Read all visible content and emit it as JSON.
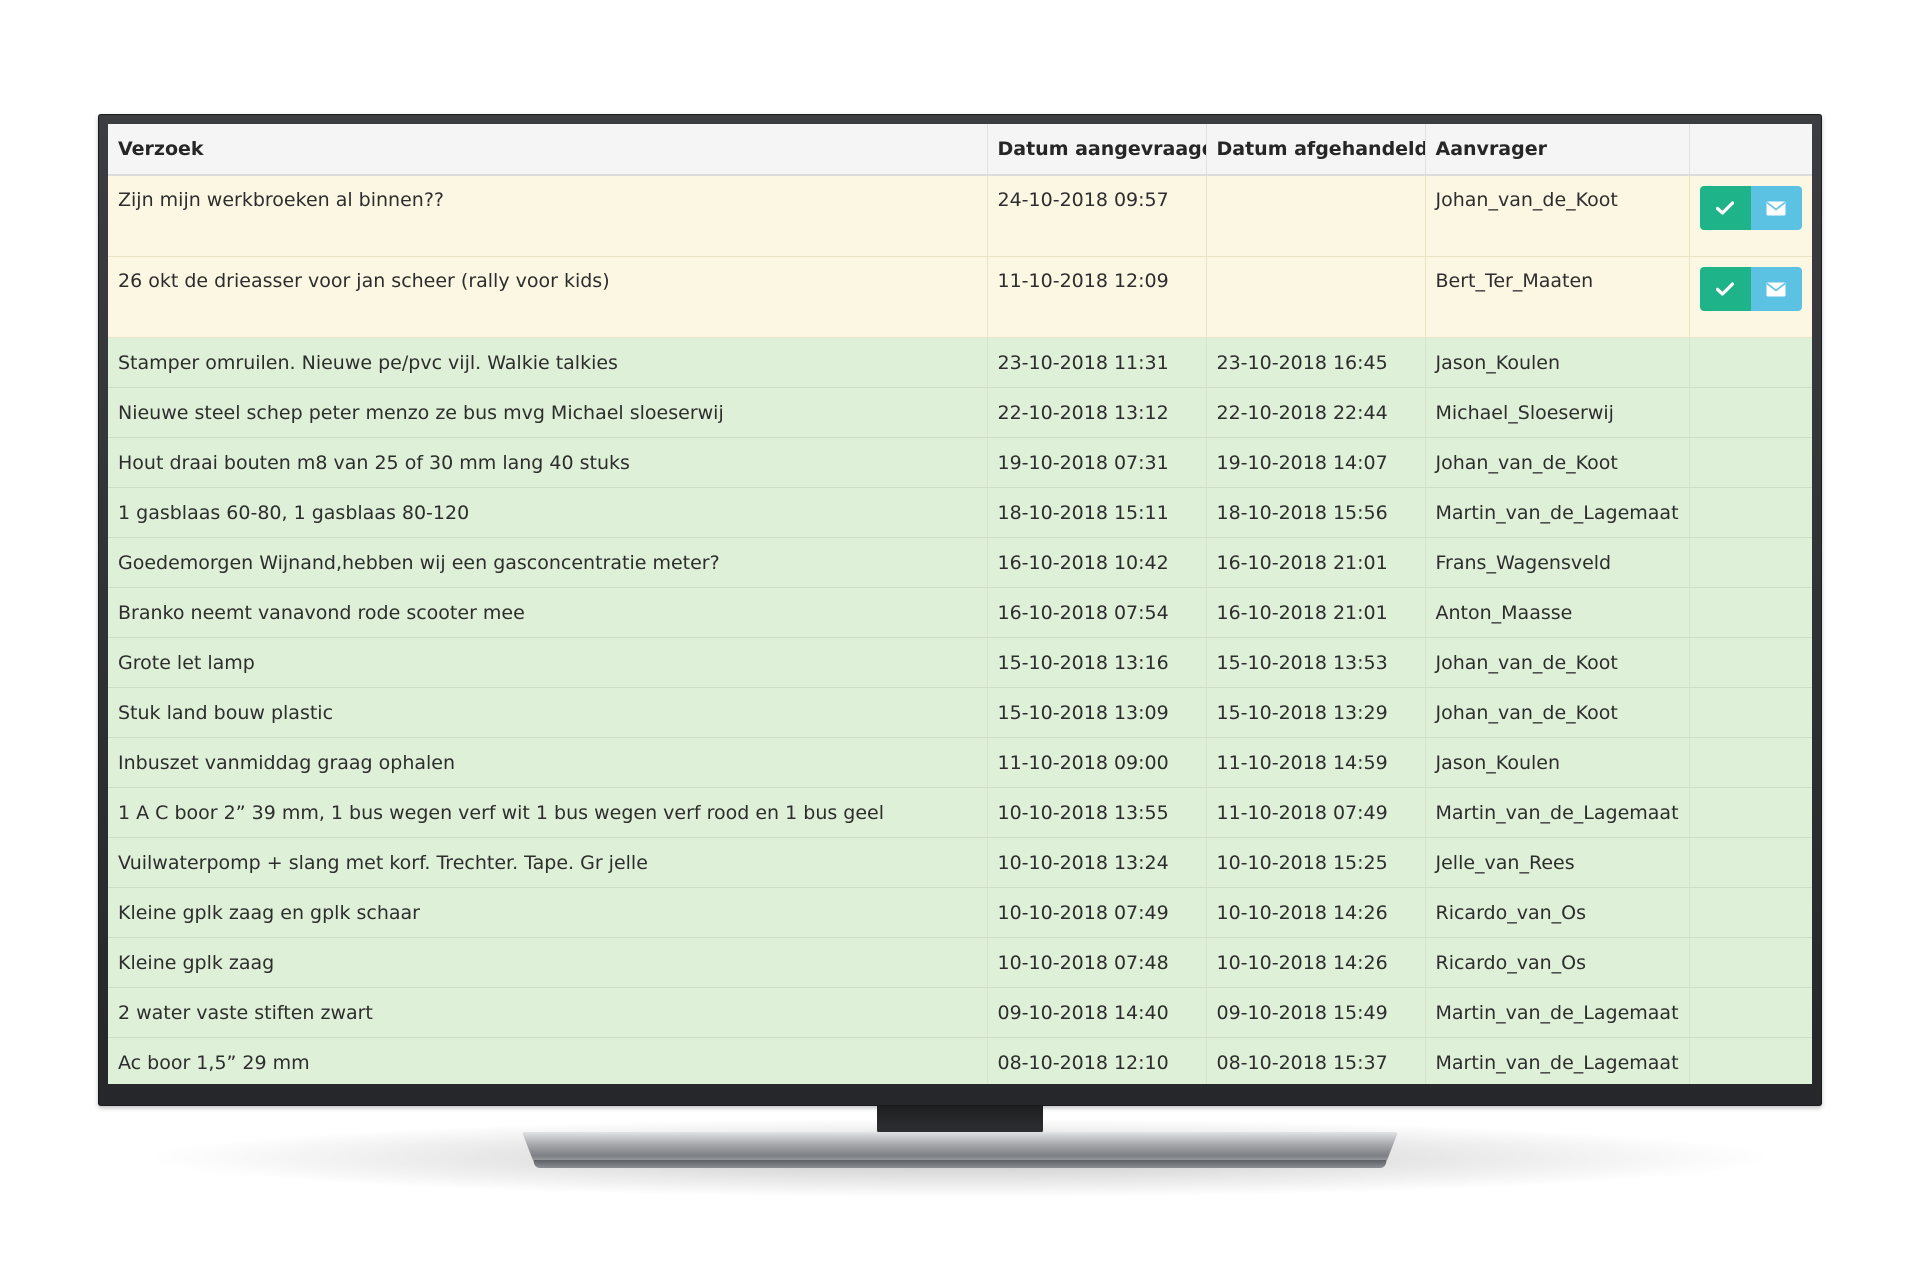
{
  "table": {
    "headers": {
      "request": "Verzoek",
      "date_requested": "Datum aangevraagd",
      "date_handled": "Datum afgehandeld",
      "requester": "Aanvrager",
      "actions": ""
    },
    "pending_rows": [
      {
        "request": "Zijn mijn werkbroeken al binnen??",
        "date_requested": "24-10-2018 09:57",
        "date_handled": "",
        "requester": "Johan_van_de_Koot"
      },
      {
        "request": "26 okt de drieasser voor jan scheer (rally voor kids)",
        "date_requested": "11-10-2018 12:09",
        "date_handled": "",
        "requester": "Bert_Ter_Maaten"
      }
    ],
    "done_rows": [
      {
        "request": "Stamper omruilen. Nieuwe pe/pvc vijl. Walkie talkies",
        "date_requested": "23-10-2018 11:31",
        "date_handled": "23-10-2018 16:45",
        "requester": "Jason_Koulen"
      },
      {
        "request": "Nieuwe steel schep peter menzo ze bus mvg Michael sloeserwij",
        "date_requested": "22-10-2018 13:12",
        "date_handled": "22-10-2018 22:44",
        "requester": "Michael_Sloeserwij"
      },
      {
        "request": "Hout draai bouten m8 van 25 of 30 mm lang 40 stuks",
        "date_requested": "19-10-2018 07:31",
        "date_handled": "19-10-2018 14:07",
        "requester": "Johan_van_de_Koot"
      },
      {
        "request": "1 gasblaas 60-80, 1 gasblaas 80-120",
        "date_requested": "18-10-2018 15:11",
        "date_handled": "18-10-2018 15:56",
        "requester": "Martin_van_de_Lagemaat"
      },
      {
        "request": "Goedemorgen Wijnand,hebben wij een gasconcentratie meter?",
        "date_requested": "16-10-2018 10:42",
        "date_handled": "16-10-2018 21:01",
        "requester": "Frans_Wagensveld"
      },
      {
        "request": "Branko neemt vanavond rode scooter mee",
        "date_requested": "16-10-2018 07:54",
        "date_handled": "16-10-2018 21:01",
        "requester": "Anton_Maasse"
      },
      {
        "request": "Grote let lamp",
        "date_requested": "15-10-2018 13:16",
        "date_handled": "15-10-2018 13:53",
        "requester": "Johan_van_de_Koot"
      },
      {
        "request": "Stuk land bouw plastic",
        "date_requested": "15-10-2018 13:09",
        "date_handled": "15-10-2018 13:29",
        "requester": "Johan_van_de_Koot"
      },
      {
        "request": "Inbuszet vanmiddag graag ophalen",
        "date_requested": "11-10-2018 09:00",
        "date_handled": "11-10-2018 14:59",
        "requester": "Jason_Koulen"
      },
      {
        "request": "1 A C boor 2” 39 mm, 1 bus wegen verf wit 1 bus wegen verf rood en 1 bus geel",
        "date_requested": "10-10-2018 13:55",
        "date_handled": "11-10-2018 07:49",
        "requester": "Martin_van_de_Lagemaat"
      },
      {
        "request": "Vuilwaterpomp + slang met korf. Trechter. Tape. Gr jelle",
        "date_requested": "10-10-2018 13:24",
        "date_handled": "10-10-2018 15:25",
        "requester": "Jelle_van_Rees"
      },
      {
        "request": "Kleine gplk zaag en gplk schaar",
        "date_requested": "10-10-2018 07:49",
        "date_handled": "10-10-2018 14:26",
        "requester": "Ricardo_van_Os"
      },
      {
        "request": "Kleine gplk zaag",
        "date_requested": "10-10-2018 07:48",
        "date_handled": "10-10-2018 14:26",
        "requester": "Ricardo_van_Os"
      },
      {
        "request": "2 water vaste stiften zwart",
        "date_requested": "09-10-2018 14:40",
        "date_handled": "09-10-2018 15:49",
        "requester": "Martin_van_de_Lagemaat"
      },
      {
        "request": "Ac boor 1,5” 29 mm",
        "date_requested": "08-10-2018 12:10",
        "date_handled": "08-10-2018 15:37",
        "requester": "Martin_van_de_Lagemaat"
      }
    ],
    "action_icons": {
      "approve": "check-icon",
      "message": "envelope-icon"
    }
  },
  "colors": {
    "pending_row": "#fcf7e3",
    "done_row": "#dff0d8",
    "approve_button": "#1fb38a",
    "message_button": "#5cc2e4"
  }
}
